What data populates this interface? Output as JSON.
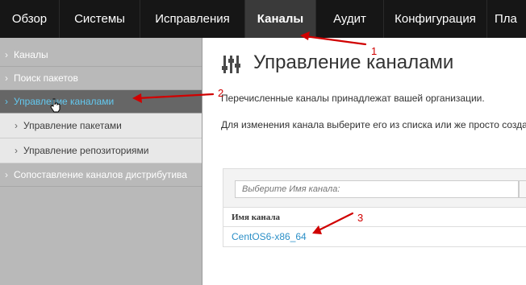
{
  "topnav": {
    "tabs": [
      {
        "label": "Обзор"
      },
      {
        "label": "Системы"
      },
      {
        "label": "Исправления"
      },
      {
        "label": "Каналы"
      },
      {
        "label": "Аудит"
      },
      {
        "label": "Конфигурация"
      },
      {
        "label": "Пла"
      }
    ],
    "active_tab": "Каналы"
  },
  "sidebar": {
    "items": [
      {
        "label": "Каналы"
      },
      {
        "label": "Поиск пакетов"
      },
      {
        "label": "Управление каналами"
      },
      {
        "label": "Управление пакетами"
      },
      {
        "label": "Управление репозиториями"
      },
      {
        "label": "Сопоставление каналов дистрибутива"
      }
    ],
    "active_item": "Управление каналами"
  },
  "main": {
    "title": "Управление каналами",
    "paragraph1": "Перечисленные каналы принадлежат вашей организации.",
    "paragraph2": "Для изменения канала выберите его из списка или же просто созда",
    "filter_placeholder": "Выберите Имя канала:",
    "column_header": "Имя канала",
    "rows": [
      {
        "name": "CentOS6-x86_64"
      }
    ]
  },
  "annotations": {
    "labels": [
      "1",
      "2",
      "3"
    ],
    "color": "#d00000"
  },
  "colors": {
    "nav_bg": "#161616",
    "nav_active": "#3a3a3a",
    "sidebar_bg": "#b9b9b9",
    "sidebar_active": "#666666",
    "active_text": "#63c8ef",
    "link": "#2b8fc7"
  }
}
